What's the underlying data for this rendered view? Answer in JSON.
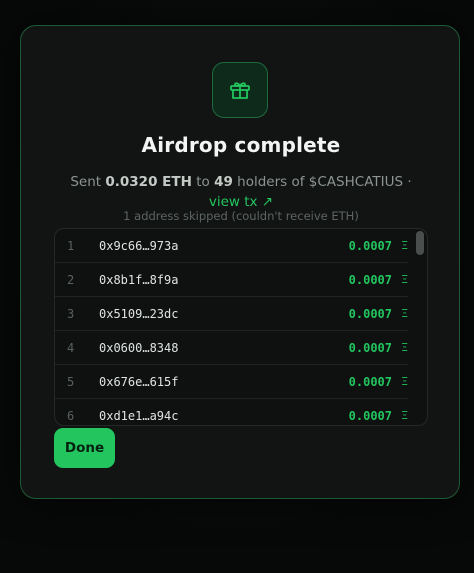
{
  "modal": {
    "title": "Airdrop complete",
    "summary": {
      "sent_prefix": "Sent",
      "amount": "0.0320 ETH",
      "to_word": "to",
      "holder_count": "49",
      "holders_of": "holders of",
      "token": "$CASHCATIUS",
      "separator": "·"
    },
    "view_tx_label": "view tx ↗",
    "skipped_note": "1 address skipped (couldn't receive ETH)",
    "eth_symbol": "Ξ",
    "recipients": [
      {
        "index": "1",
        "address": "0x9c66…973a",
        "amount": "0.0007"
      },
      {
        "index": "2",
        "address": "0x8b1f…8f9a",
        "amount": "0.0007"
      },
      {
        "index": "3",
        "address": "0x5109…23dc",
        "amount": "0.0007"
      },
      {
        "index": "4",
        "address": "0x0600…8348",
        "amount": "0.0007"
      },
      {
        "index": "5",
        "address": "0x676e…615f",
        "amount": "0.0007"
      },
      {
        "index": "6",
        "address": "0xd1e1…a94c",
        "amount": "0.0007"
      }
    ],
    "done_label": "Done"
  },
  "colors": {
    "accent": "#22c55e",
    "modal_bg": "#121413",
    "modal_border": "#1f5a37"
  },
  "icons": {
    "header": "gift-icon",
    "external_link": "arrow-up-right-icon"
  }
}
